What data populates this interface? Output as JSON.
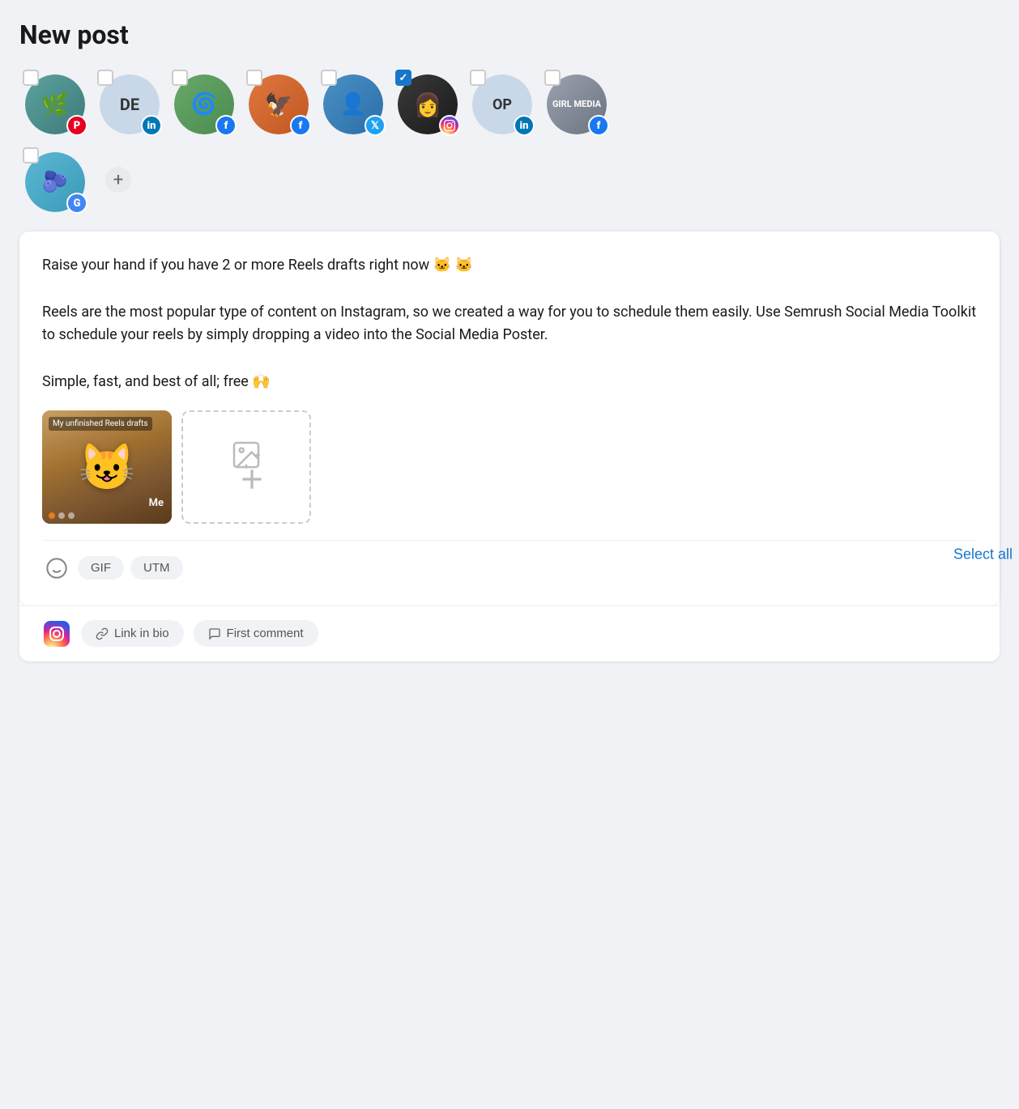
{
  "page": {
    "title": "New post"
  },
  "select_all_label": "Select all",
  "accounts": [
    {
      "id": "acc1",
      "initials": "",
      "bg": "teal",
      "checked": false,
      "social": "pinterest",
      "hasPhoto": true,
      "photoColor": "#5ba3a0"
    },
    {
      "id": "acc2",
      "initials": "DE",
      "bg": "lightgray",
      "checked": false,
      "social": "linkedin",
      "hasPhoto": false
    },
    {
      "id": "acc3",
      "initials": "",
      "bg": "green",
      "checked": false,
      "social": "facebook",
      "hasPhoto": true,
      "photoColor": "#68a86b"
    },
    {
      "id": "acc4",
      "initials": "",
      "bg": "orange",
      "checked": false,
      "social": "facebook",
      "hasPhoto": true,
      "photoColor": "#e07840"
    },
    {
      "id": "acc5",
      "initials": "",
      "bg": "blue",
      "checked": false,
      "social": "twitter",
      "hasPhoto": true,
      "photoColor": "#4a90c4"
    },
    {
      "id": "acc6",
      "initials": "",
      "bg": "dark",
      "checked": true,
      "social": "instagram",
      "hasPhoto": true,
      "photoColor": "#2d2d2d"
    },
    {
      "id": "acc7",
      "initials": "OP",
      "bg": "lightblue",
      "checked": false,
      "social": "linkedin",
      "hasPhoto": false
    },
    {
      "id": "acc8",
      "initials": "",
      "bg": "gray",
      "checked": false,
      "social": "facebook",
      "hasPhoto": true,
      "photoColor": "#9ca3af"
    },
    {
      "id": "acc9",
      "initials": "",
      "bg": "teal2",
      "checked": false,
      "social": "google",
      "hasPhoto": true,
      "photoColor": "#5bb8d4"
    }
  ],
  "post": {
    "text": "Raise your hand if you have 2 or more Reels drafts right now 🐱 🐱\n\nReels are the most popular type of content on Instagram, so we created a way for you to schedule them easily. Use Semrush Social Media Toolkit to schedule your reels by simply dropping a video into the Social Media Poster.\n\nSimple, fast, and best of all; free 🙌"
  },
  "toolbar": {
    "gif_label": "GIF",
    "utm_label": "UTM"
  },
  "footer": {
    "link_in_bio_label": "Link in bio",
    "first_comment_label": "First comment"
  },
  "media": {
    "thumb_top_label": "My unfinished Reels drafts",
    "thumb_me_label": "Me"
  }
}
